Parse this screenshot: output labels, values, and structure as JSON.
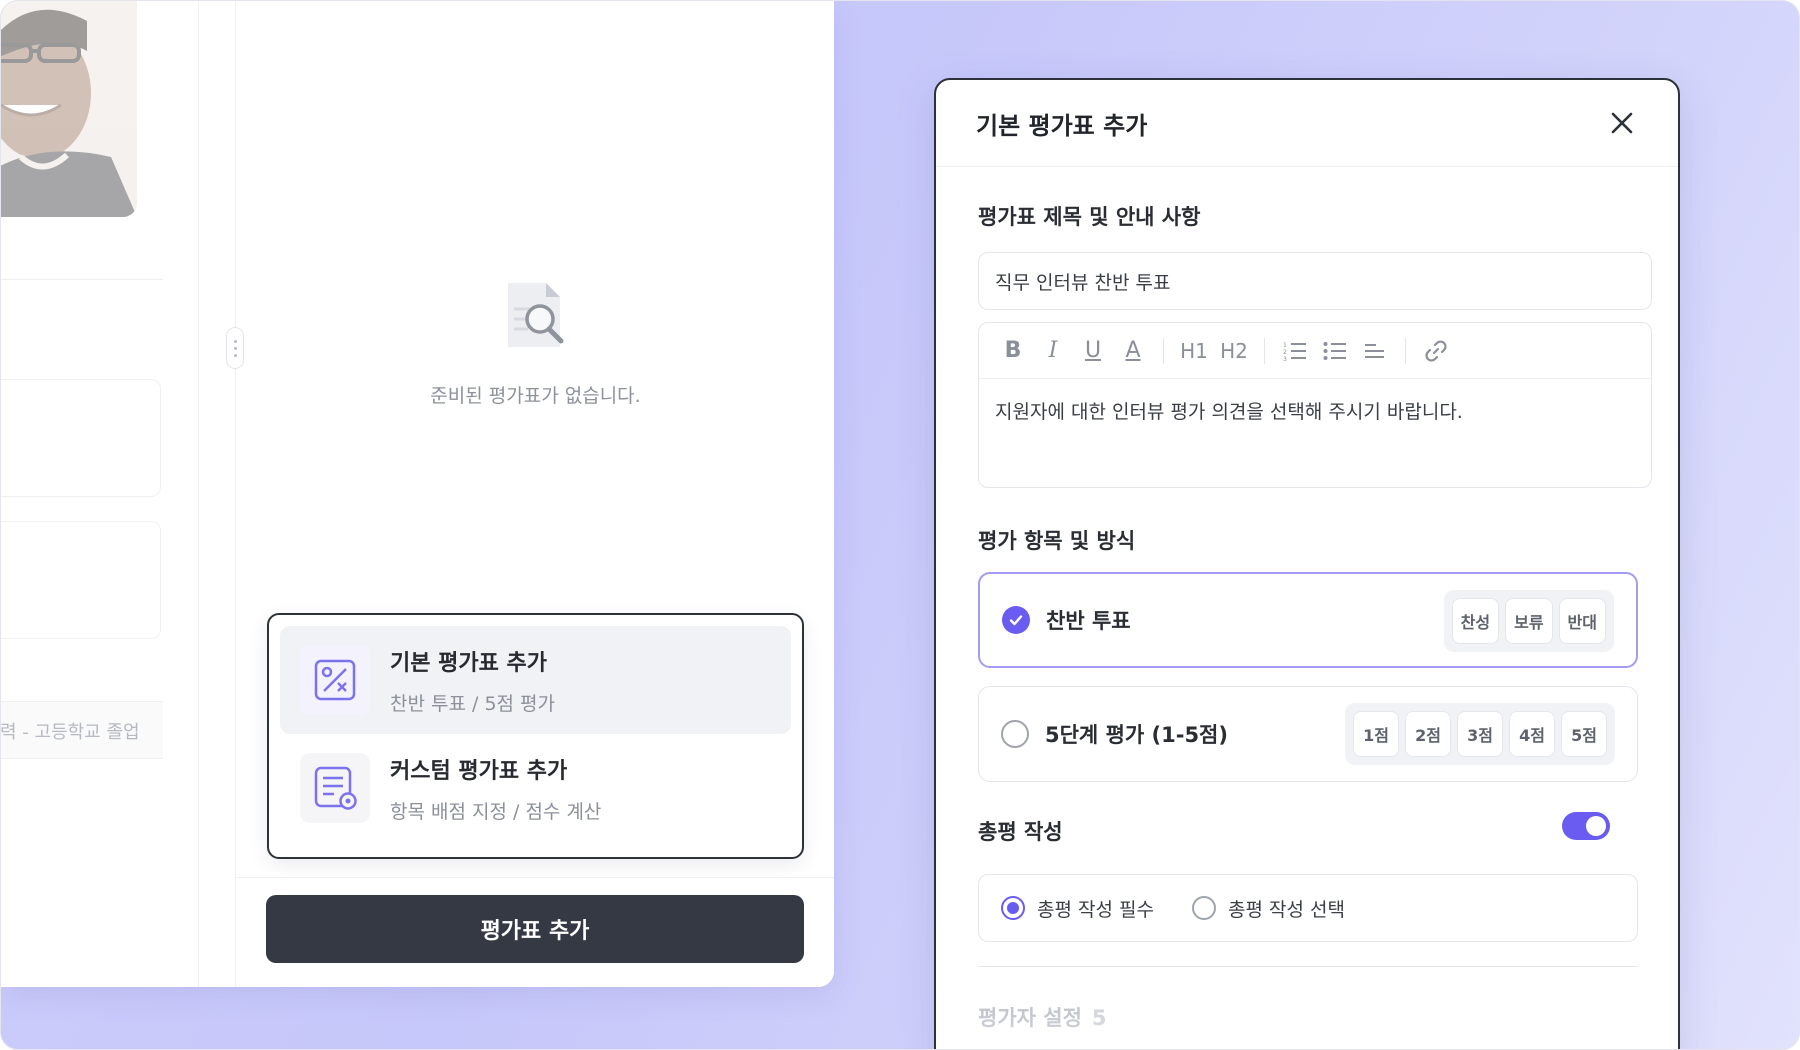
{
  "left_panel": {
    "education_text": "력 - 고등학교 졸업"
  },
  "center_panel": {
    "empty_message": "준비된 평가표가 없습니다.",
    "menu": [
      {
        "title": "기본 평가표 추가",
        "subtitle": "찬반 투표 / 5점 평가",
        "icon": "percent-icon"
      },
      {
        "title": "커스텀 평가표 추가",
        "subtitle": "항목 배점 지정 / 점수 계산",
        "icon": "custom-form-icon"
      }
    ],
    "add_button_label": "평가표 추가"
  },
  "dialog": {
    "title": "기본 평가표 추가",
    "section_title": "평가표 제목 및 안내 사항",
    "title_value": "직무 인터뷰 찬반 투표",
    "toolbar": [
      "B",
      "I",
      "U",
      "A",
      "H1",
      "H2",
      "ordered-list",
      "bullet-list",
      "align-left",
      "link"
    ],
    "description": "지원자에 대한 인터뷰 평가 의견을 선택해 주시기 바랍니다.",
    "method_section_title": "평가 항목 및 방식",
    "options": [
      {
        "label": "찬반 투표",
        "selected": true,
        "chips": [
          "찬성",
          "보류",
          "반대"
        ]
      },
      {
        "label": "5단계 평가 (1-5점)",
        "selected": false,
        "chips": [
          "1점",
          "2점",
          "3점",
          "4점",
          "5점"
        ]
      }
    ],
    "summary_section_title": "총평 작성",
    "summary_toggle_on": true,
    "summary_options": [
      {
        "label": "총평 작성 필수",
        "selected": true
      },
      {
        "label": "총평 작성 선택",
        "selected": false
      }
    ],
    "evaluator_label": "평가자 설정",
    "evaluator_count": "5"
  },
  "colors": {
    "accent": "#6a5cf0",
    "button_dark": "#343944",
    "background_gradient": "#c6c7fa"
  }
}
